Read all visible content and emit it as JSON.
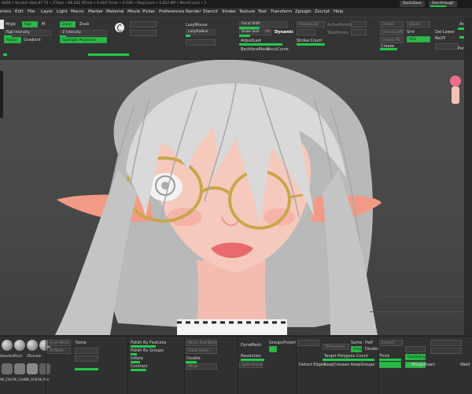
{
  "status": {
    "text": "6469 • Scratch Disk 67.75 • ZTime • 66.202 RTime • 0.419 Timer • 0.039 • PolyCount • 2.612 MP • MeshCount • 3",
    "quicksave": "QuickSave",
    "seethrough": "See-through"
  },
  "menu": [
    "Alphas",
    "Brush",
    "Color",
    "Document",
    "Draw",
    "Dynamics",
    "Edit",
    "File",
    "Layer",
    "Light",
    "Macro",
    "Marker",
    "Material",
    "Movie",
    "Picker",
    "Preferences",
    "Render",
    "Stencil",
    "Stroke",
    "Texture",
    "Tool",
    "Transform",
    "Zplugin",
    "Zscript",
    "Help"
  ],
  "toolbar": {
    "mrgb": "Mrgb",
    "rgb": "Rgb",
    "m": "M",
    "zadd": "Zadd",
    "zsub": "Zsub",
    "rgb_intensity": "Rgb Intensity",
    "z_intensity": "Z Intensity",
    "spotlight_projection": "Spotlight Projection",
    "radial": "Radial",
    "gradient": "Gradient",
    "lazy_mouse": "LazyMouse",
    "lazy_radius": "LazyRadius",
    "focal_shift": "Focal Shift",
    "draw_size": "Draw Size",
    "draw_size_value": "64",
    "dynamic": "Dynamic",
    "adjust_last": "AdjustLast",
    "backface_mask": "BackfaceMask",
    "accu_curve": "AccuCurve",
    "replay_last": "ReplayLast",
    "stroke_count": "Stroke Count",
    "active_points": "ActivePoints",
    "total_points": "TotalPoints",
    "create": "Create",
    "divide": "Divide",
    "uncreasepg": "UnCreasePG",
    "crease_pg": "Crease PG",
    "del_lower": "Del Lower",
    "del_higher": "Del Higher",
    "smt": "Smt",
    "suv": "SUV",
    "reuv": "ReUV",
    "actv": "Activ",
    "pers": "Pers",
    "dif": "Dif"
  },
  "bottom": {
    "from_mesh": "From Mesh",
    "to_mesh": "To Mesh",
    "noise": "Noise",
    "polish_by_features": "Polish By Features",
    "polish_by_groups": "Polish By Groups",
    "inflate": "Inflate",
    "contract": "Contract",
    "mirror_and_weld": "Mirror And Weld",
    "close_holes": "Close Holes",
    "double": "Double",
    "mirror": "Mirror",
    "dynamesh": "DynaMesh",
    "groups": "Groups",
    "project": "Project",
    "resolution": "Resolution",
    "split_unmasked": "Split Unmasked",
    "detect_edges": "Detect Edges",
    "keep_creases": "KeepCreases",
    "keep_groups": "KeepGroups",
    "zremesher": "ZRemesher",
    "same": "Same",
    "half": "Half",
    "adapt": "Adapt",
    "double2": "Double",
    "target_polygons_count": "Target Polygons Count",
    "thick": "Thick",
    "geometry": "Geometry",
    "merge_down": "MergeDown",
    "weld": "Weld",
    "extract": "Extract",
    "brush_names": [
      "Standard",
      "Pinch",
      "ZRemesh",
      "Dam_Standard",
      "Move"
    ],
    "brush_row2": [
      "SK_Clot",
      "SK_Cloth",
      "SK_AirB",
      "SK_Pen"
    ]
  }
}
